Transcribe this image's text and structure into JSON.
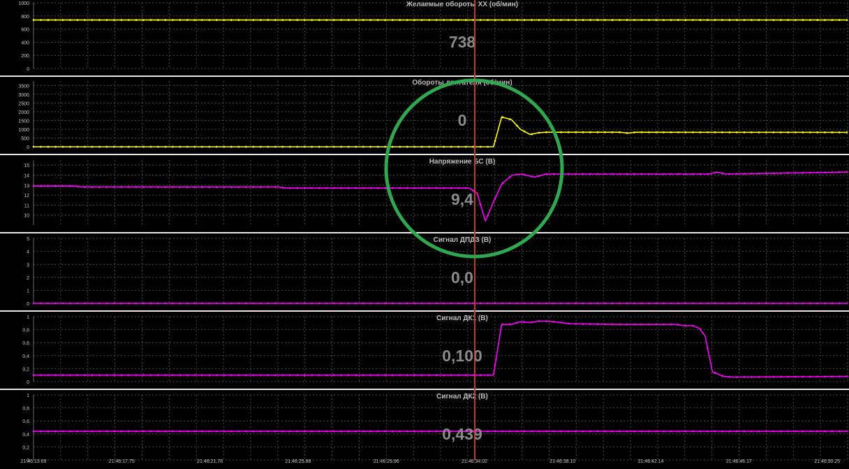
{
  "colors": {
    "background": "#000000",
    "grid": "#4a4a4a",
    "separator": "#e6e6e6",
    "tick_text": "#c8c8c8",
    "title_text": "#bdbdbd",
    "cursor": "#c0392b",
    "cursor_value": "#8a8a8a",
    "yellow": "#ffff00",
    "magenta": "#ff00ff",
    "highlight_circle": "#2fa84f"
  },
  "cursor": {
    "time_label": "21:46:34.02"
  },
  "time_axis": {
    "labels": [
      "21:46:13.69",
      "21:46:17.75",
      "21:46:21.76",
      "21:46:25.88",
      "21:46:29.96",
      "21:46:34.02",
      "21:46:38.10",
      "21:46:42.14",
      "21:46:46.17",
      "21:46:50.25"
    ]
  },
  "chart_data": [
    {
      "type": "line",
      "title": "Желаемые обороты ХХ  (об/мин)",
      "cursor_value": "738",
      "ylim": [
        0,
        1000
      ],
      "yticks": [
        "0",
        "200",
        "400",
        "600",
        "800",
        "1000"
      ],
      "color": "yellow",
      "grid": true,
      "series": [
        {
          "x": [
            0,
            100
          ],
          "y": [
            738,
            738
          ]
        }
      ]
    },
    {
      "type": "line",
      "title": "Обороты двигателя  (об/мин)",
      "cursor_value": "0",
      "ylim": [
        0,
        3750
      ],
      "yticks": [
        "0",
        "500",
        "1000",
        "1500",
        "2000",
        "2500",
        "3000",
        "3500"
      ],
      "color": "yellow",
      "grid": true,
      "series": [
        {
          "x": [
            0,
            55.5,
            56.5,
            57.5,
            58.7,
            59.8,
            61,
            62,
            63,
            72,
            73,
            74,
            100
          ],
          "y": [
            0,
            0,
            0,
            1700,
            1550,
            1000,
            700,
            800,
            830,
            830,
            780,
            830,
            820
          ]
        }
      ]
    },
    {
      "type": "line",
      "title": "Напряжение БС  (В)",
      "cursor_value": "9,4",
      "ylim": [
        9,
        15.5
      ],
      "yticks": [
        "10",
        "11",
        "12",
        "13",
        "14",
        "15"
      ],
      "color": "magenta",
      "grid": true,
      "series": [
        {
          "x": [
            0,
            5,
            6,
            30,
            31,
            52.5,
            53.5,
            54.5,
            55.5,
            56.5,
            57.5,
            58.8,
            60,
            61.5,
            63,
            65,
            83,
            84,
            85,
            100
          ],
          "y": [
            12.9,
            12.9,
            12.8,
            12.8,
            12.7,
            12.7,
            12.7,
            12.2,
            9.4,
            11.3,
            13.1,
            14.0,
            14.1,
            13.8,
            14.1,
            14.1,
            14.1,
            14.3,
            14.1,
            14.3
          ]
        }
      ]
    },
    {
      "type": "line",
      "title": "Сигнал ДПДЗ  (В)",
      "cursor_value": "0,0",
      "ylim": [
        0,
        5
      ],
      "yticks": [
        "0",
        "1",
        "2",
        "3",
        "4",
        "5"
      ],
      "color": "magenta",
      "grid": true,
      "series": [
        {
          "x": [
            0,
            100
          ],
          "y": [
            0,
            0
          ]
        }
      ]
    },
    {
      "type": "line",
      "title": "Сигнал ДК1  (В)",
      "cursor_value": "0,100",
      "ylim": [
        0,
        1
      ],
      "yticks": [
        "0",
        "0,2",
        "0,4",
        "0,6",
        "0,8",
        "1"
      ],
      "color": "magenta",
      "grid": true,
      "series": [
        {
          "x": [
            0,
            56.5,
            57.5,
            58.7,
            59.7,
            61,
            62,
            63,
            64,
            66,
            72,
            79,
            80,
            81,
            81.8,
            82.5,
            83.4,
            84.8,
            86,
            100
          ],
          "y": [
            0.1,
            0.1,
            0.88,
            0.88,
            0.92,
            0.91,
            0.93,
            0.93,
            0.92,
            0.89,
            0.88,
            0.88,
            0.86,
            0.86,
            0.82,
            0.7,
            0.15,
            0.08,
            0.07,
            0.08
          ]
        }
      ]
    },
    {
      "type": "line",
      "title": "Сигнал ДК2  (В)",
      "cursor_value": "0,439",
      "ylim": [
        0,
        1
      ],
      "yticks": [
        "0",
        "0,2",
        "0,4",
        "0,6",
        "0,8",
        "1"
      ],
      "color": "magenta",
      "grid": true,
      "series": [
        {
          "x": [
            0,
            100
          ],
          "y": [
            0.44,
            0.44
          ]
        }
      ]
    }
  ]
}
